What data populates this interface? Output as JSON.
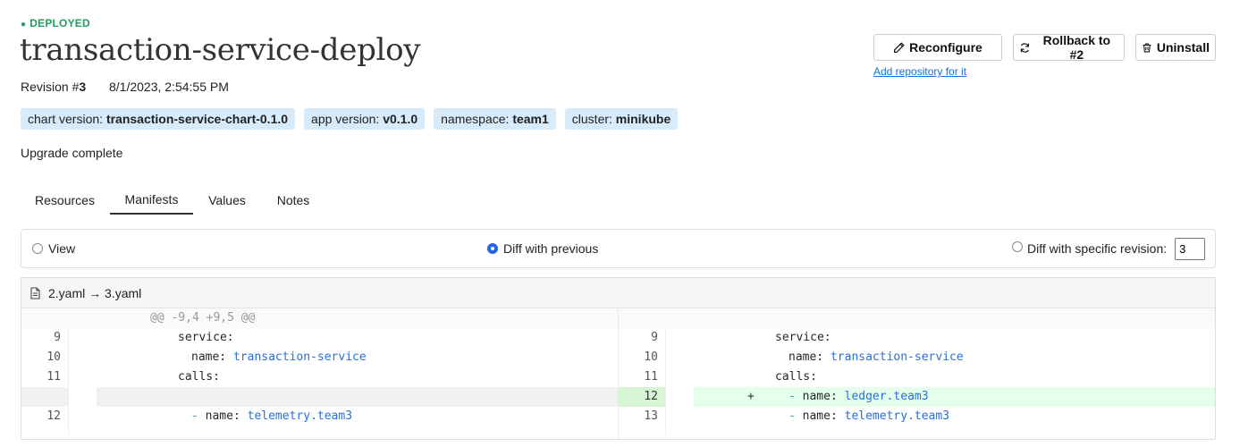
{
  "header": {
    "status_dot": "●",
    "status": "DEPLOYED",
    "title": "transaction-service-deploy",
    "revision_label": "Revision #",
    "revision_number": "3",
    "revision_date": "8/1/2023, 2:54:55 PM",
    "badges": [
      {
        "key": "chart version: ",
        "value": "transaction-service-chart-0.1.0"
      },
      {
        "key": "app version: ",
        "value": "v0.1.0"
      },
      {
        "key": "namespace: ",
        "value": "team1"
      },
      {
        "key": "cluster: ",
        "value": "minikube"
      }
    ],
    "upgrade_status": "Upgrade complete"
  },
  "actions": {
    "reconfigure_label": "Reconfigure",
    "rollback_label": "Rollback to #2",
    "uninstall_label": "Uninstall",
    "add_repository_link": "Add repository for it",
    "icons": {
      "reconfigure": "pencil-icon",
      "rollback": "refresh-icon",
      "uninstall": "trash-icon"
    }
  },
  "tabs": [
    {
      "label": "Resources",
      "active": false
    },
    {
      "label": "Manifests",
      "active": true
    },
    {
      "label": "Values",
      "active": false
    },
    {
      "label": "Notes",
      "active": false
    }
  ],
  "view_options": {
    "view_label": "View",
    "diff_previous_label": "Diff with previous",
    "diff_specific_label": "Diff with specific revision:",
    "specific_revision_value": "3",
    "selected": "diff_previous"
  },
  "diff": {
    "file_title": "2.yaml → 3.yaml",
    "hunk_header": "@@ -9,4 +9,5 @@",
    "left_lines": [
      {
        "num": "9",
        "indent": "    ",
        "key": "service:",
        "value": ""
      },
      {
        "num": "10",
        "indent": "      ",
        "key": "name: ",
        "value": "transaction-service"
      },
      {
        "num": "11",
        "indent": "    ",
        "key": "calls:",
        "value": ""
      },
      {
        "num": "",
        "indent": "",
        "key": "",
        "value": ""
      },
      {
        "num": "12",
        "indent": "      ",
        "key": "- ",
        "value": "name: ",
        "value2": "telemetry.team3"
      }
    ],
    "right_lines": [
      {
        "num": "9",
        "indent": "    ",
        "key": "service:",
        "value": ""
      },
      {
        "num": "10",
        "indent": "      ",
        "key": "name: ",
        "value": "transaction-service"
      },
      {
        "num": "11",
        "indent": "    ",
        "key": "calls:",
        "value": ""
      },
      {
        "num": "12",
        "marker": "+",
        "indent": "      ",
        "key": "- ",
        "value": "name: ",
        "value2": "ledger.team3"
      },
      {
        "num": "13",
        "indent": "      ",
        "key": "- ",
        "value": "name: ",
        "value2": "telemetry.team3"
      }
    ],
    "colors": {
      "added_line": "#e6ffec",
      "added_number": "#d5f5d5",
      "value_text": "#2b6fd6"
    }
  },
  "colors": {
    "status": "#22a060",
    "badge_bg": "#d8ebfa",
    "radio_selected": "#2563eb",
    "link": "#1a6fd6"
  }
}
